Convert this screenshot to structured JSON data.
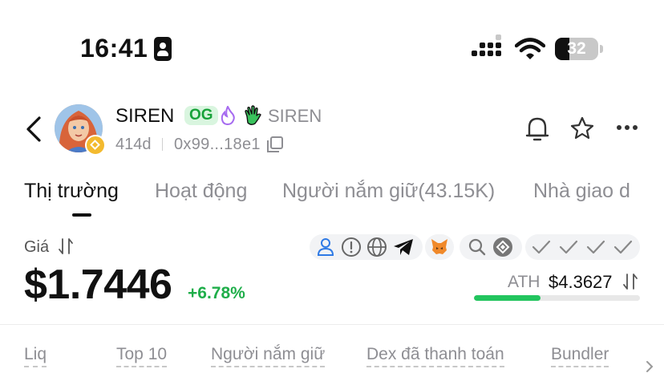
{
  "status_bar": {
    "time": "16:41",
    "battery": "32",
    "icons": [
      "contact-card-icon",
      "cellular-signal-icon",
      "wifi-icon",
      "battery-icon"
    ]
  },
  "token": {
    "name": "SIREN",
    "og_badge": "OG",
    "symbol": "SIREN",
    "age": "414d",
    "address": "0x99...18e1",
    "chain_icon": "bnb-chain-icon"
  },
  "tabs": [
    {
      "label": "Thị trường",
      "active": true
    },
    {
      "label": "Hoạt động",
      "active": false
    },
    {
      "label": "Người nắm giữ(43.15K)",
      "active": false
    },
    {
      "label": "Nhà giao d",
      "active": false
    }
  ],
  "price_section": {
    "label": "Giá",
    "price": "$1.7446",
    "change": "+6.78%",
    "ath_label": "ATH",
    "ath_value": "$4.3627",
    "ath_progress": 0.4
  },
  "social_icons": [
    "user-icon",
    "alert-icon",
    "globe-icon",
    "telegram-icon"
  ],
  "audit_icons": [
    "metamask-fox-icon"
  ],
  "tool_icons": [
    "search-icon",
    "bnb-scan-icon"
  ],
  "check_icons": [
    "check-icon",
    "check-icon",
    "check-icon",
    "check-icon"
  ],
  "metrics": [
    "Liq",
    "Top 10",
    "Người nắm giữ",
    "Dex đã thanh toán",
    "Bundler"
  ],
  "colors": {
    "positive": "#1fae4a",
    "ath_bar": "#22c55e",
    "og_bg": "#d9f5df",
    "og_text": "#18a23a",
    "muted": "#8e8e93"
  }
}
